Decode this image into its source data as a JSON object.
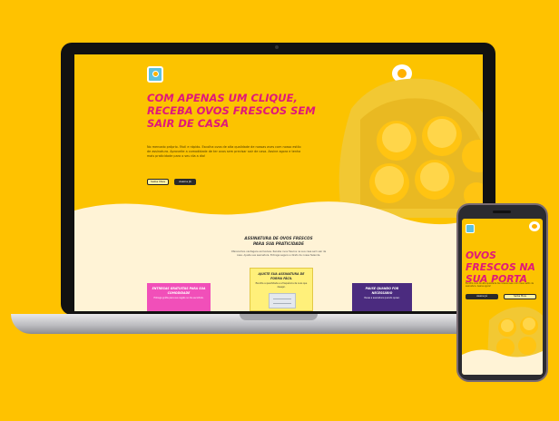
{
  "laptop": {
    "hero_title": "COM APENAS UM CLIQUE, RECEBA OVOS FRESCOS SEM SAIR DE CASA",
    "hero_text": "No mercado próprio. Fácil e rápido. Escolha ovos de alta qualidade de nossas aves com nosso estilo de assinatura. Aproveite a comodidade de ter ovos sem precisar sair de casa. Assine agora e tenha mais praticidade para o seu dia a dia!",
    "btn_primary": "Saiba Mais",
    "btn_secondary": "Assine Já",
    "section_title": "ASSINATURA DE OVOS FRESCOS PARA SUA PRATICIDADE",
    "section_text": "Oferecemos vantagens exclusivas. Receba ovos frescos na sua casa sem sair de casa. Ajuste sua assinatura. Entrega segura e direto de nossa fazenda.",
    "cards": [
      {
        "title": "ENTREGAS GRATUITAS PARA SUA COMODIDADE",
        "text": "Entrega grátis para sua região no dia escolhido."
      },
      {
        "title": "AJUSTE SUA ASSINATURA DE FORMA FÁCIL",
        "text": "Escolha a quantidade e a frequência de ovos que desejar."
      },
      {
        "title": "PAUSE QUANDO FOR NECESSÁRIO",
        "text": "Pause a assinatura quando quiser."
      }
    ]
  },
  "phone": {
    "hero_title": "OVOS FRESCOS NA SUA PORTA",
    "hero_text": "Escolha ovos de alta qualidade das nossas aves com nosso estilo de assinatura. Assine agora!",
    "btn_primary": "Assine Já",
    "btn_secondary": "Saiba Mais"
  },
  "colors": {
    "background": "#ffc200",
    "accent_pink": "#e0187a",
    "cream": "#fff3d6",
    "purple": "#4b2b7f",
    "card_pink": "#f14fb9"
  }
}
